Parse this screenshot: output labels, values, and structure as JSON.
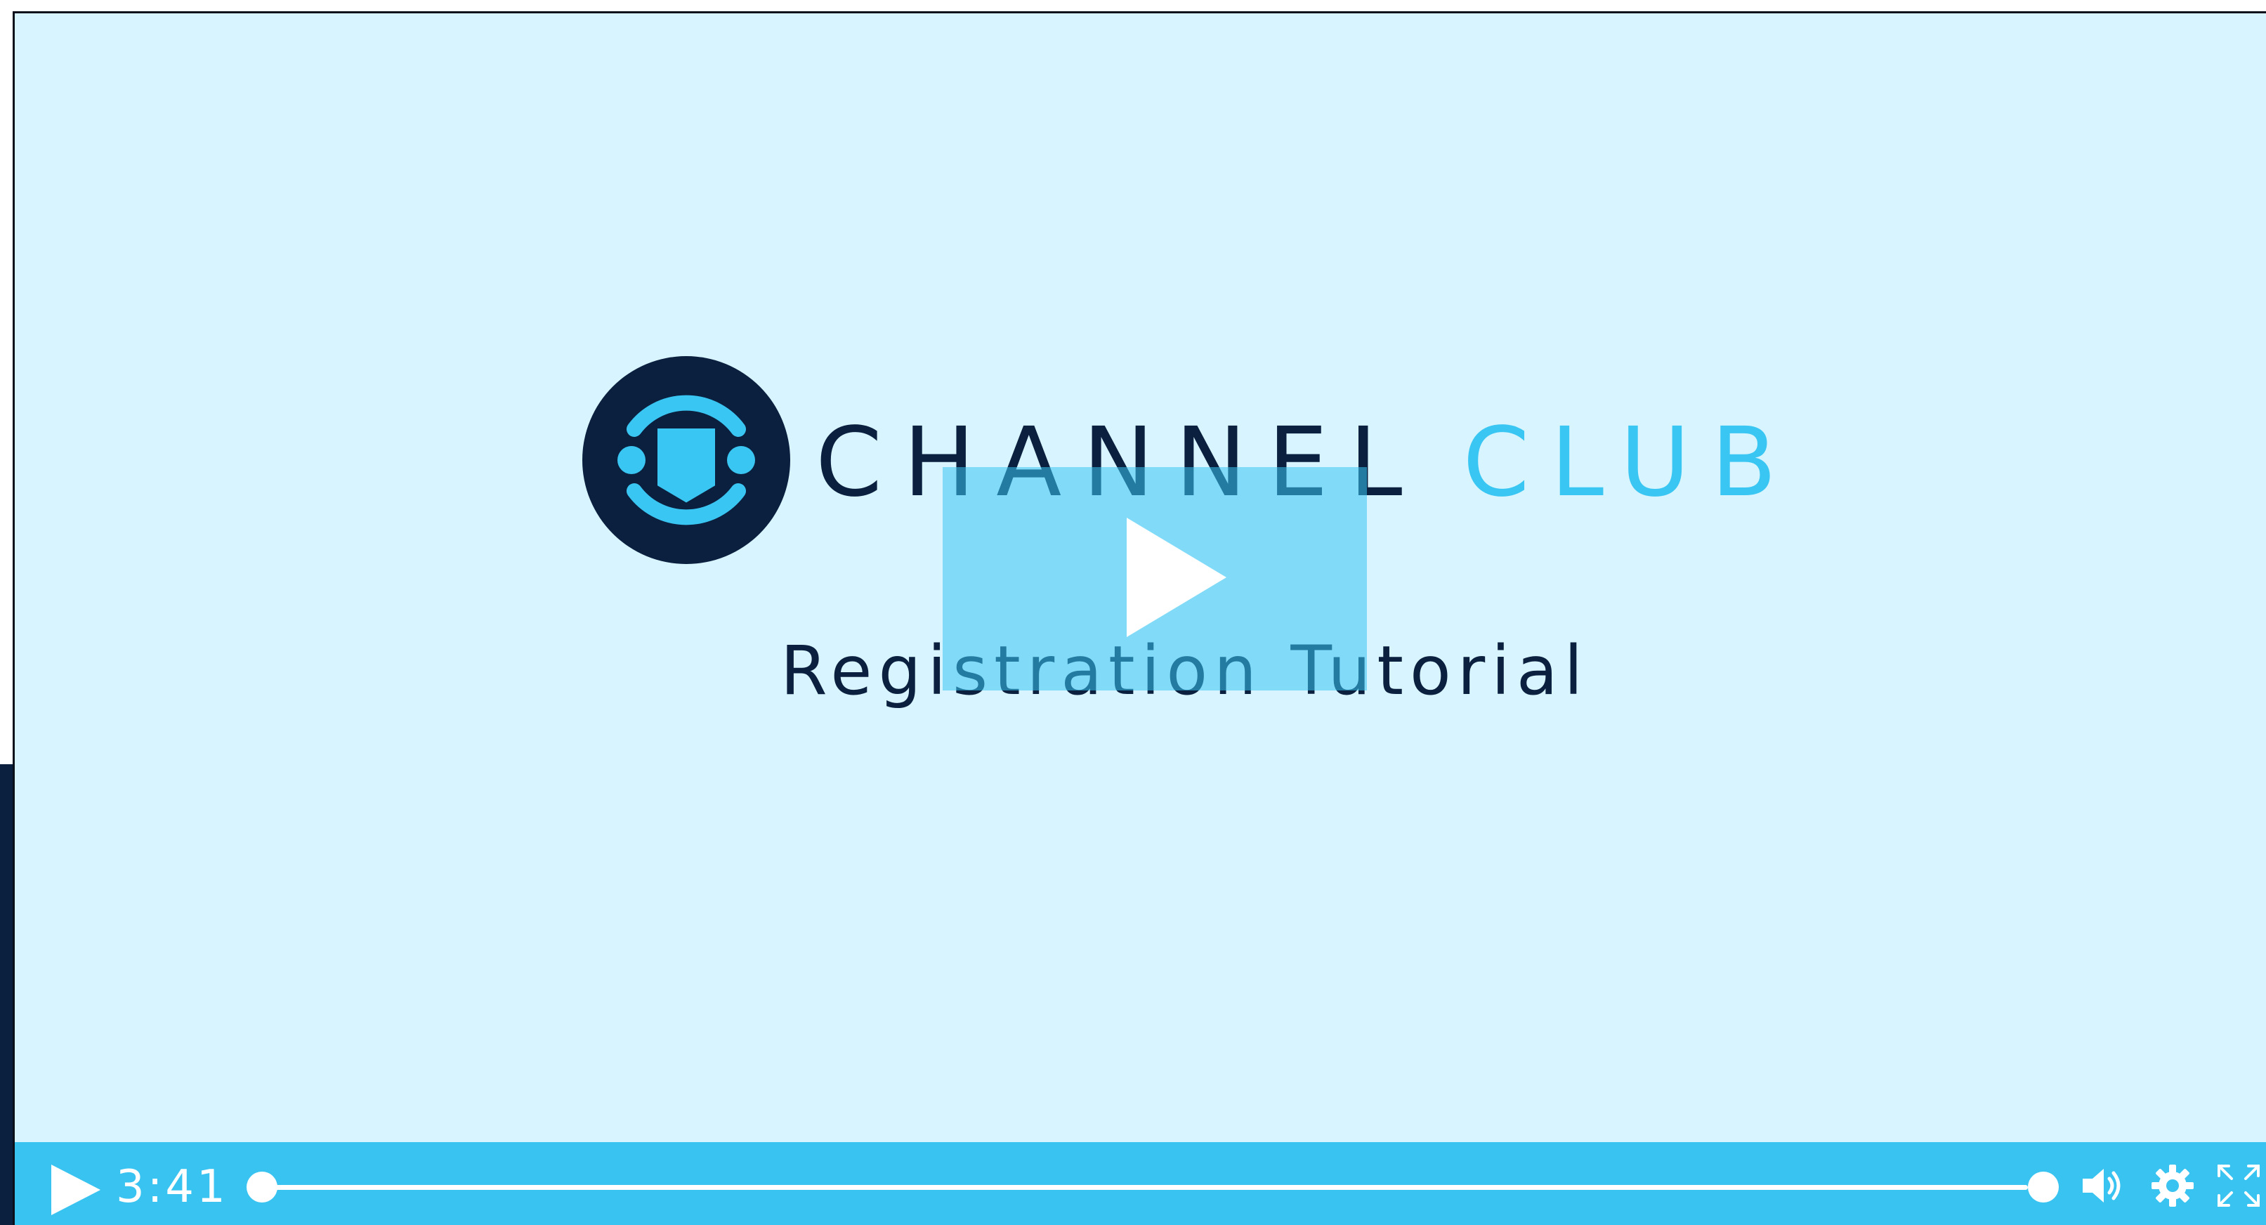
{
  "colors": {
    "background": "#d8f4fe",
    "navy": "#0b1f3f",
    "accent": "#3ac6f2",
    "control_bar": "#39c3f1",
    "overlay": "rgba(58,198,242,0.55)"
  },
  "brand": {
    "name_part1": "CHANNEL",
    "name_part2": "CLUB",
    "logo_icon": "channel-club-logo-icon"
  },
  "video": {
    "subtitle": "Registration Tutorial",
    "big_play_icon": "play-icon",
    "progress_fraction": 0.0
  },
  "controls": {
    "play_icon": "play-icon",
    "time": "3:41",
    "volume_icon": "volume-icon",
    "settings_icon": "gear-icon",
    "fullscreen_icon": "fullscreen-icon"
  }
}
